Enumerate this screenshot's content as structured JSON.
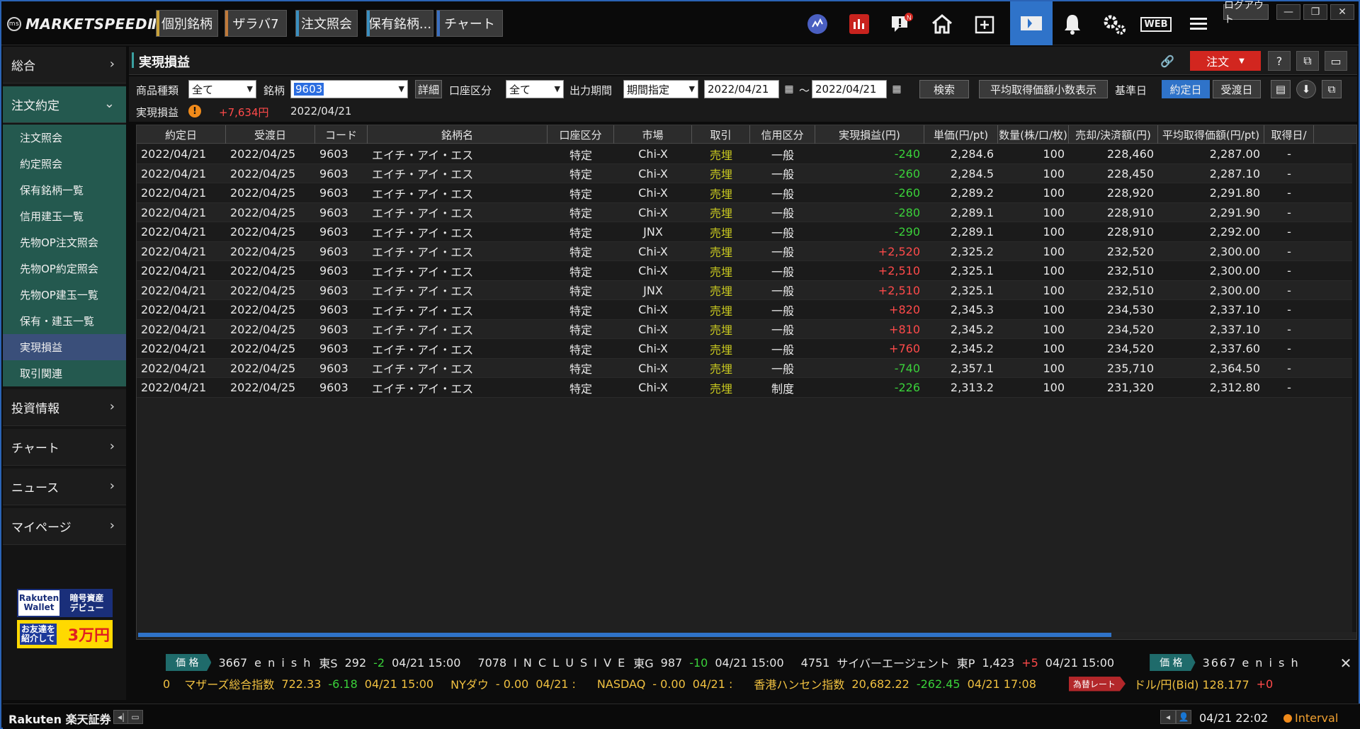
{
  "app": {
    "logo": "MARKETSPEEDⅡ",
    "tabs": [
      "個別銘柄",
      "ザラバ7",
      "注文照会",
      "保有銘柄...",
      "チャート"
    ],
    "logout_label": "ログアウト",
    "notification_badge": "N",
    "web_label": "WEB"
  },
  "sidebar": {
    "sections": [
      {
        "label": "総合"
      },
      {
        "label": "注文約定"
      },
      {
        "label": "投資情報"
      },
      {
        "label": "チャート"
      },
      {
        "label": "ニュース"
      },
      {
        "label": "マイページ"
      }
    ],
    "items": [
      {
        "label": "注文照会"
      },
      {
        "label": "約定照会"
      },
      {
        "label": "保有銘柄一覧"
      },
      {
        "label": "信用建玉一覧"
      },
      {
        "label": "先物OP注文照会"
      },
      {
        "label": "先物OP約定照会"
      },
      {
        "label": "先物OP建玉一覧"
      },
      {
        "label": "保有・建玉一覧"
      },
      {
        "label": "実現損益"
      },
      {
        "label": "取引関連"
      }
    ],
    "promo1": {
      "brand_top": "Rakuten",
      "brand_bottom": "Wallet",
      "text_top": "暗号資産",
      "text_bottom": "デビュー"
    },
    "promo2": {
      "text_top": "お友達を",
      "text_bottom": "紹介して",
      "amount": "3万円"
    }
  },
  "main": {
    "title": "実現損益",
    "order_button": "注文",
    "filters": {
      "product_label": "商品種類",
      "product_value": "全て",
      "symbol_label": "銘柄",
      "symbol_value": "9603",
      "detail_button": "詳細",
      "account_label": "口座区分",
      "account_value": "全て",
      "period_label": "出力期間",
      "period_value": "期間指定",
      "date_from": "2022/04/21",
      "tilde": "～",
      "date_to": "2022/04/21",
      "search_button": "検索",
      "avg_button": "平均取得価額小数表示",
      "base_date_label": "基準日",
      "trade_date_button": "約定日",
      "settle_date_button": "受渡日"
    },
    "summary": {
      "label": "実現損益",
      "warn": "!",
      "value": "+7,634円",
      "date": "2022/04/21"
    }
  },
  "table": {
    "columns": [
      "約定日",
      "受渡日",
      "コード",
      "銘柄名",
      "口座区分",
      "市場",
      "取引",
      "信用区分",
      "実現損益(円)",
      "単価(円/pt)",
      "数量(株/口/枚)",
      "売却/決済額(円)",
      "平均取得価額(円/pt)",
      "取得日/"
    ],
    "rows": [
      [
        "2022/04/21",
        "2022/04/25",
        "9603",
        "エイチ・アイ・エス",
        "特定",
        "Chi-X",
        "売埋",
        "一般",
        "-240",
        "2,284.6",
        "100",
        "228,460",
        "2,287.00"
      ],
      [
        "2022/04/21",
        "2022/04/25",
        "9603",
        "エイチ・アイ・エス",
        "特定",
        "Chi-X",
        "売埋",
        "一般",
        "-260",
        "2,284.5",
        "100",
        "228,450",
        "2,287.10"
      ],
      [
        "2022/04/21",
        "2022/04/25",
        "9603",
        "エイチ・アイ・エス",
        "特定",
        "Chi-X",
        "売埋",
        "一般",
        "-260",
        "2,289.2",
        "100",
        "228,920",
        "2,291.80"
      ],
      [
        "2022/04/21",
        "2022/04/25",
        "9603",
        "エイチ・アイ・エス",
        "特定",
        "Chi-X",
        "売埋",
        "一般",
        "-280",
        "2,289.1",
        "100",
        "228,910",
        "2,291.90"
      ],
      [
        "2022/04/21",
        "2022/04/25",
        "9603",
        "エイチ・アイ・エス",
        "特定",
        "JNX",
        "売埋",
        "一般",
        "-290",
        "2,289.1",
        "100",
        "228,910",
        "2,292.00"
      ],
      [
        "2022/04/21",
        "2022/04/25",
        "9603",
        "エイチ・アイ・エス",
        "特定",
        "Chi-X",
        "売埋",
        "一般",
        "+2,520",
        "2,325.2",
        "100",
        "232,520",
        "2,300.00"
      ],
      [
        "2022/04/21",
        "2022/04/25",
        "9603",
        "エイチ・アイ・エス",
        "特定",
        "Chi-X",
        "売埋",
        "一般",
        "+2,510",
        "2,325.1",
        "100",
        "232,510",
        "2,300.00"
      ],
      [
        "2022/04/21",
        "2022/04/25",
        "9603",
        "エイチ・アイ・エス",
        "特定",
        "JNX",
        "売埋",
        "一般",
        "+2,510",
        "2,325.1",
        "100",
        "232,510",
        "2,300.00"
      ],
      [
        "2022/04/21",
        "2022/04/25",
        "9603",
        "エイチ・アイ・エス",
        "特定",
        "Chi-X",
        "売埋",
        "一般",
        "+820",
        "2,345.3",
        "100",
        "234,530",
        "2,337.10"
      ],
      [
        "2022/04/21",
        "2022/04/25",
        "9603",
        "エイチ・アイ・エス",
        "特定",
        "Chi-X",
        "売埋",
        "一般",
        "+810",
        "2,345.2",
        "100",
        "234,520",
        "2,337.10"
      ],
      [
        "2022/04/21",
        "2022/04/25",
        "9603",
        "エイチ・アイ・エス",
        "特定",
        "Chi-X",
        "売埋",
        "一般",
        "+760",
        "2,345.2",
        "100",
        "234,520",
        "2,337.60"
      ],
      [
        "2022/04/21",
        "2022/04/25",
        "9603",
        "エイチ・アイ・エス",
        "特定",
        "Chi-X",
        "売埋",
        "一般",
        "-740",
        "2,357.1",
        "100",
        "235,710",
        "2,364.50"
      ],
      [
        "2022/04/21",
        "2022/04/25",
        "9603",
        "エイチ・アイ・エス",
        "特定",
        "Chi-X",
        "売埋",
        "制度",
        "-226",
        "2,313.2",
        "100",
        "231,320",
        "2,312.80"
      ]
    ],
    "trailing_cell": "-",
    "horizontal_scroll_visible_fraction": 0.8
  },
  "ticker": {
    "line1": {
      "badge": "価 格",
      "items": [
        {
          "code": "3667",
          "name": "e n i s h",
          "market": "東S",
          "price": "292",
          "change": "-2",
          "time": "04/21 15:00"
        },
        {
          "code": "7078",
          "name": "I N C L U S I V E",
          "market": "東G",
          "price": "987",
          "change": "-10",
          "time": "04/21 15:00"
        },
        {
          "code": "4751",
          "name": "サイバーエージェント",
          "market": "東P",
          "price": "1,423",
          "change": "+5",
          "time": "04/21 15:00"
        }
      ],
      "badge2": "価 格",
      "tail": "3667 e n i s h"
    },
    "line2": {
      "lead": "0",
      "items": [
        {
          "name": "マザーズ総合指数",
          "price": "722.33",
          "change": "-6.18",
          "time": "04/21 15:00"
        },
        {
          "name": "NYダウ",
          "price": "- 0.00",
          "change": "",
          "time": "04/21 :"
        },
        {
          "name": "NASDAQ",
          "price": "- 0.00",
          "change": "",
          "time": "04/21 :"
        },
        {
          "name": "香港ハンセン指数",
          "price": "20,682.22",
          "change": "-262.45",
          "time": "04/21 17:08"
        }
      ],
      "badge": "為替レート",
      "fx": "ドル/円(Bid) 128.177",
      "fx_change": "+0"
    }
  },
  "statusbar": {
    "brand": "Rakuten 楽天証券",
    "time": "04/21 22:02",
    "interval": "Interval"
  },
  "colors": {
    "accent": "#2f73c9",
    "order": "#d2261f",
    "positive": "#ff4a4a",
    "negative": "#3ad13a",
    "sell": "#c8c820",
    "sidebar_open": "#24594f"
  }
}
